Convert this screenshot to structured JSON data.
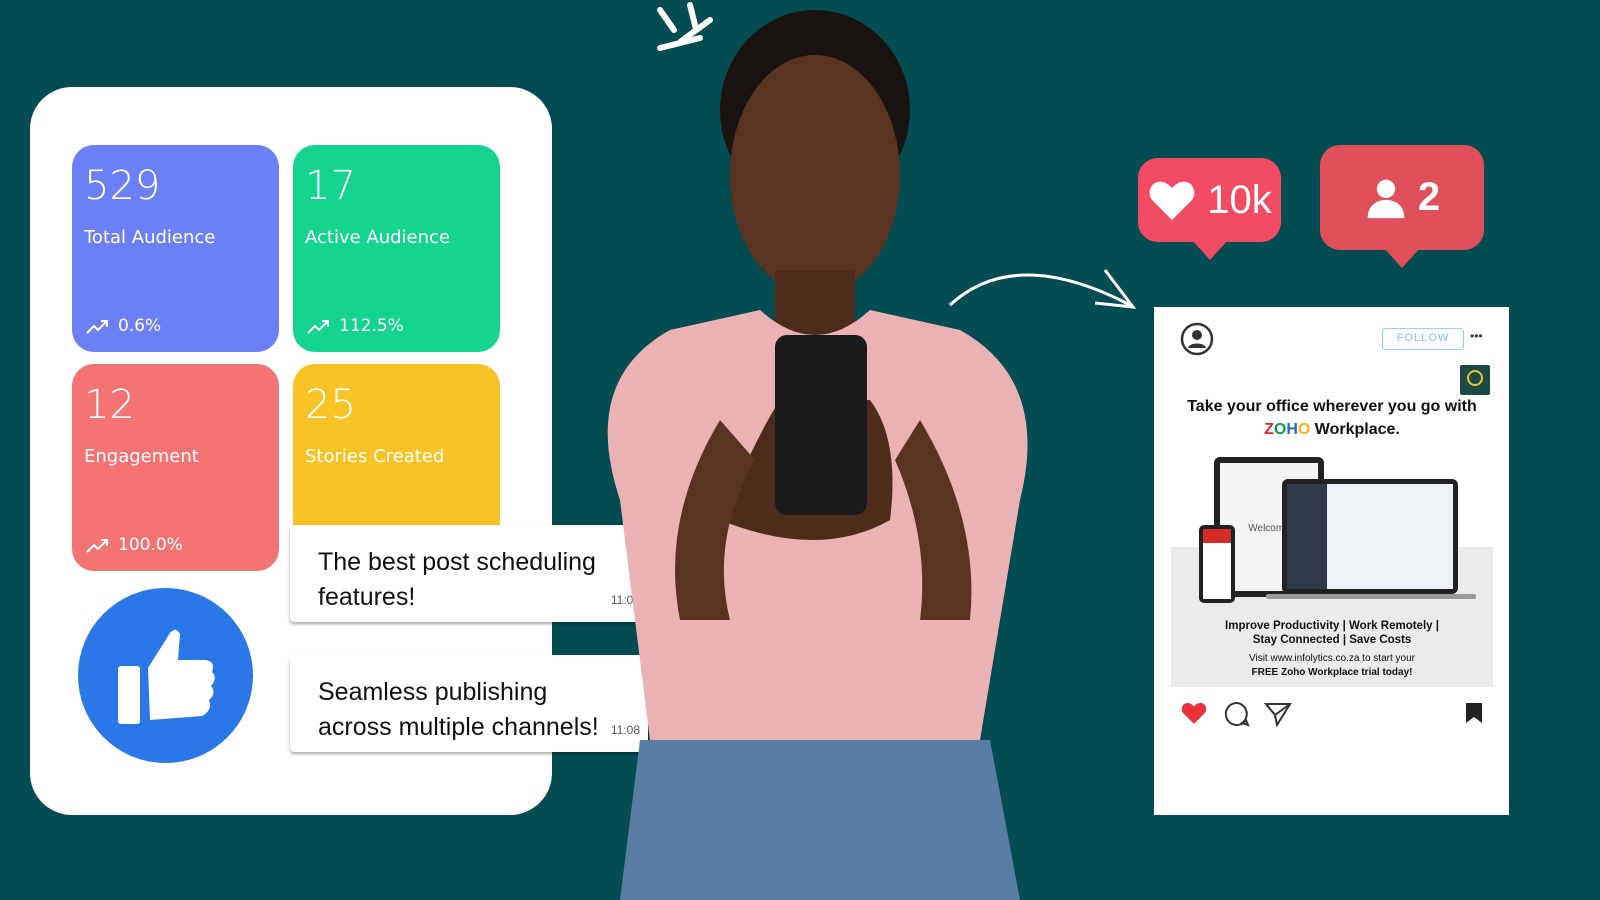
{
  "stats": [
    {
      "value": "529",
      "label": "Total Audience",
      "trend": "0.6%",
      "color": "#6b80f5"
    },
    {
      "value": "17",
      "label": "Active Audience",
      "trend": "112.5%",
      "color": "#15d490"
    },
    {
      "value": "12",
      "label": "Engagement",
      "trend": "100.0%",
      "color": "#f47373"
    },
    {
      "value": "25",
      "label": "Stories Created",
      "color": "#f8c325"
    }
  ],
  "messages": [
    {
      "text": "The best post scheduling features!",
      "time": "11:08"
    },
    {
      "text": "Seamless publishing across multiple channels!",
      "time": "11:08"
    }
  ],
  "notifications": {
    "likes": "10k",
    "followers": "2"
  },
  "post": {
    "follow_label": "FOLLOW",
    "more": "•••",
    "headline_a": "Take your office wherever you go with ",
    "brand_letters": [
      "Z",
      "O",
      "H",
      "O"
    ],
    "brand_colors": [
      "#e42527",
      "#089949",
      "#226db4",
      "#f9b21d"
    ],
    "headline_b": " Workplace.",
    "benefits_line1": "Improve Productivity | Work Remotely |",
    "benefits_line2": "Stay Connected | Save Costs",
    "cta_line1": "Visit www.infolytics.co.za to start your",
    "cta_line2": "FREE Zoho Workplace trial today!",
    "welcome": "Welcome"
  },
  "colors": {
    "background": "#034c51",
    "thumbs": "#2a77e8",
    "like_bubble": "#f24b64",
    "follow_bubble": "#e0505a"
  }
}
